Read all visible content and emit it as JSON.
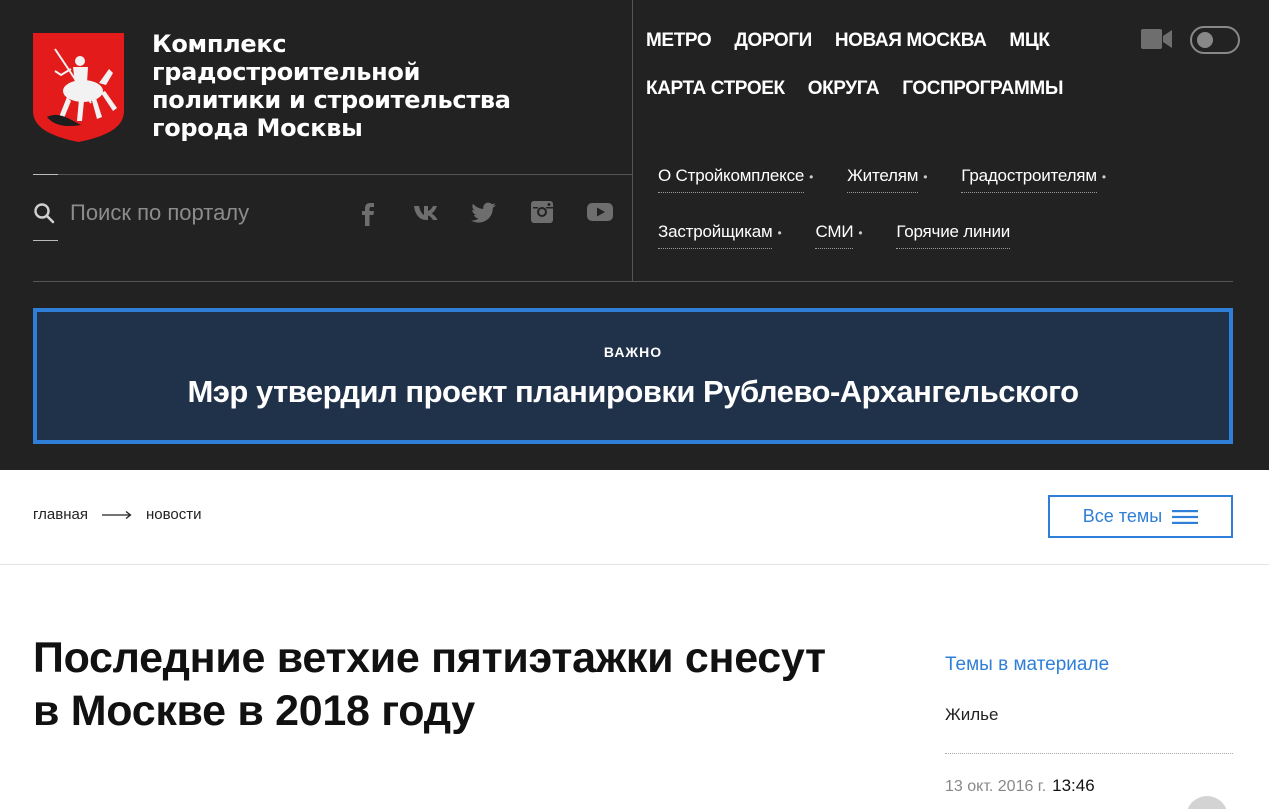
{
  "header": {
    "site_title_lines": [
      "Комплекс",
      "градостроительной",
      "политики и строительства",
      "города Москвы"
    ],
    "search_placeholder": "Поиск по порталу",
    "top_nav_row1": [
      "МЕТРО",
      "ДОРОГИ",
      "НОВАЯ МОСКВА",
      "МЦК"
    ],
    "top_nav_row2": [
      "КАРТА СТРОЕК",
      "ОКРУГА",
      "ГОСПРОГРАММЫ"
    ],
    "sub_nav_row1": [
      "О Стройкомплексе",
      "Жителям",
      "Градостроителям"
    ],
    "sub_nav_row2": [
      "Застройщикам",
      "СМИ",
      "Горячие линии"
    ],
    "socials": [
      "facebook-icon",
      "vk-icon",
      "twitter-icon",
      "instagram-icon",
      "youtube-icon"
    ]
  },
  "alert": {
    "tag": "ВАЖНО",
    "title": "Мэр утвердил проект планировки Рублево-Архангельского"
  },
  "breadcrumb": {
    "home": "главная",
    "current": "новости"
  },
  "topics_button": "Все темы",
  "article": {
    "title_lines": [
      "Последние ветхие пятиэтажки снесут",
      "в Москве в 2018 году"
    ]
  },
  "sidebar": {
    "heading": "Темы в материале",
    "topic": "Жилье",
    "date": "13 окт. 2016 г.",
    "time": "13:46"
  },
  "colors": {
    "header_bg": "#222222",
    "accent": "#2f7fd8",
    "alert_bg": "#20314a"
  }
}
